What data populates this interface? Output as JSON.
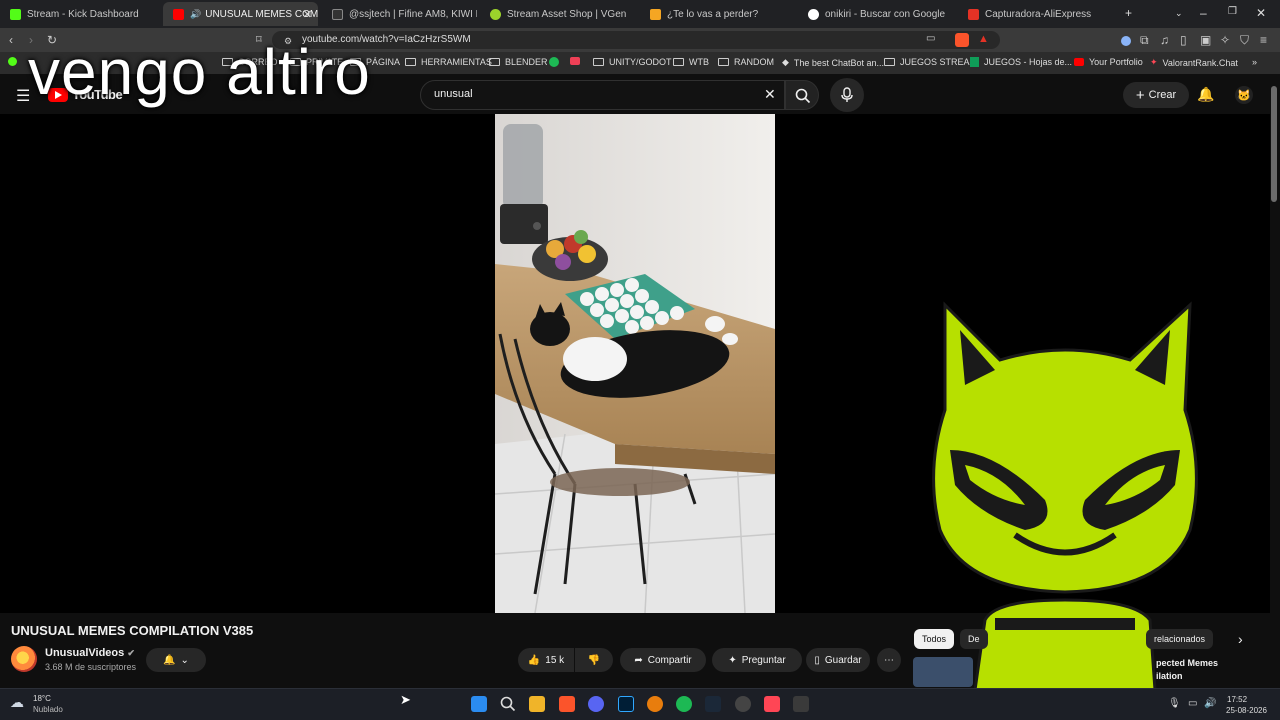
{
  "browser": {
    "tabs": [
      {
        "label": "Stream - Kick Dashboard",
        "color": "#53fc18",
        "active": false
      },
      {
        "label": "UNUSUAL MEMES COMPILA",
        "color": "#ff0000",
        "active": true
      },
      {
        "label": "@ssjtech | Fifine AM8, KIWI EARS E",
        "color": "#333333",
        "active": false
      },
      {
        "label": "Stream Asset Shop | VGen",
        "color": "#9bd32b",
        "active": false
      },
      {
        "label": "¿Te lo vas a perder?",
        "color": "#f5a623",
        "active": false
      },
      {
        "label": "onikiri - Buscar con Google",
        "color": "#ffffff",
        "active": false
      },
      {
        "label": "Capturadora-AliExpress",
        "color": "#e43225",
        "active": false
      }
    ],
    "url": "youtube.com/watch?v=IaCzHzrS5WM",
    "bookmarks": [
      {
        "label": "CORREO",
        "type": "folder"
      },
      {
        "label": "PRIVATE",
        "type": "folder"
      },
      {
        "label": "PÁGINA",
        "type": "folder"
      },
      {
        "label": "HERRAMIENTAS",
        "type": "folder"
      },
      {
        "label": "BLENDER",
        "type": "folder"
      },
      {
        "label": "UNITY/GODOT",
        "type": "folder"
      },
      {
        "label": "WTB",
        "type": "folder"
      },
      {
        "label": "RANDOM",
        "type": "folder"
      },
      {
        "label": "The best ChatBot an...",
        "type": "link"
      },
      {
        "label": "JUEGOS STREAM",
        "type": "folder"
      },
      {
        "label": "JUEGOS - Hojas de...",
        "type": "link"
      },
      {
        "label": "Your Portfolio",
        "type": "link"
      },
      {
        "label": "ValorantRank.Chat",
        "type": "link"
      }
    ]
  },
  "overlay": {
    "text": "vengo altiro"
  },
  "youtube": {
    "logo": "YouTube",
    "search": {
      "value": "unusual"
    },
    "create_label": "Crear",
    "video": {
      "title": "UNUSUAL MEMES COMPILATION V385",
      "channel": "UnusualVideos",
      "subscribers": "3.68 M de suscriptores",
      "likes": "15 k",
      "share_label": "Compartir",
      "ask_label": "Preguntar",
      "save_label": "Guardar"
    },
    "chips": [
      "Todos",
      "De",
      "relacionados"
    ],
    "sidebar_snippet": [
      "pected Memes",
      "ilation"
    ]
  },
  "taskbar": {
    "weather_temp": "18°C",
    "weather_desc": "Nublado",
    "time": "17:52",
    "date": "25-08-2026"
  },
  "colors": {
    "mascot": "#b7e000",
    "background": "#0f0f0f",
    "youtube_red": "#ff0000"
  }
}
